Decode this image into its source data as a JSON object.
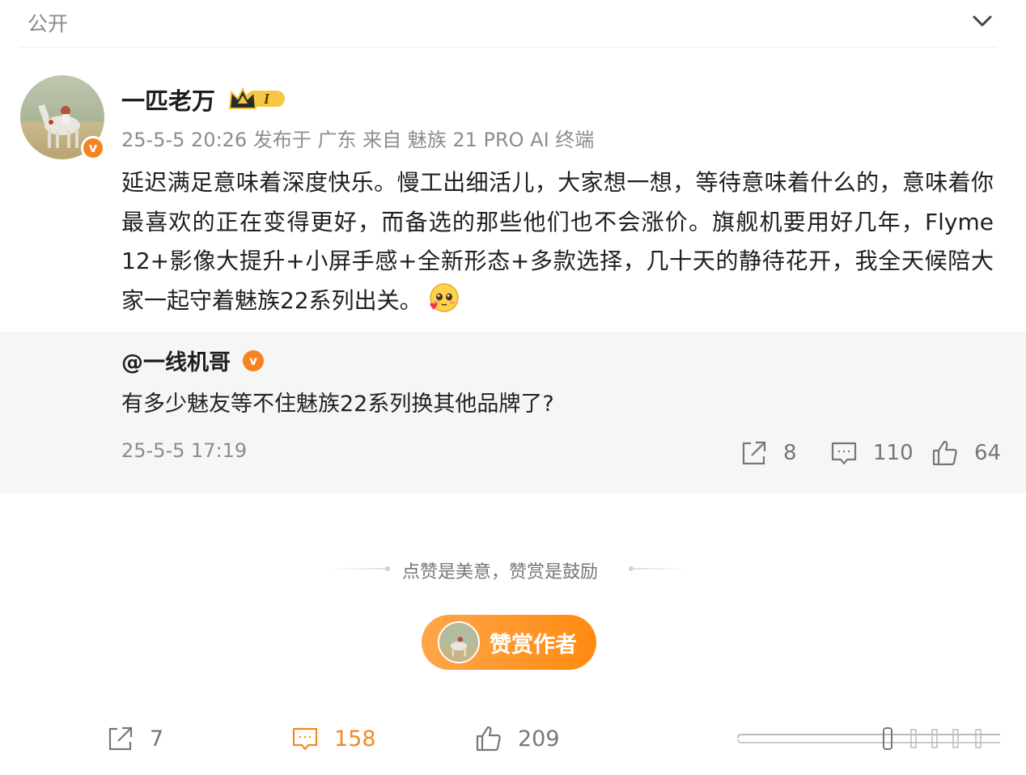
{
  "header": {
    "visibility": "公开"
  },
  "post": {
    "author": "一匹老万",
    "member_level": "I",
    "meta": "25-5-5 20:26 发布于 广东 来自 魅族 21 PRO AI 终端",
    "body": "延迟满足意味着深度快乐。慢工出细活儿，大家想一想，等待意味着什么的，意味着你最喜欢的正在变得更好，而备选的那些他们也不会涨价。旗舰机要用好几年，Flyme 12+影像大提升+小屏手感+全新形态+多款选择，几十天的静待花开，我全天候陪大家一起守着魅族22系列出关。",
    "verified_mark": "v"
  },
  "repost": {
    "author": "@一线机哥",
    "verified_mark": "v",
    "text": "有多少魅友等不住魅族22系列换其他品牌了?",
    "time": "25-5-5 17:19",
    "shares": "8",
    "comments": "110",
    "likes": "64"
  },
  "reward": {
    "hint": "点赞是美意，赞赏是鼓励",
    "button_label": "赞赏作者"
  },
  "bottom_bar": {
    "shares": "7",
    "comments": "158",
    "likes": "209"
  },
  "colors": {
    "accent_orange": "#f5841f",
    "comment_active": "#f28a20",
    "repost_bg": "#f6f6f6"
  }
}
